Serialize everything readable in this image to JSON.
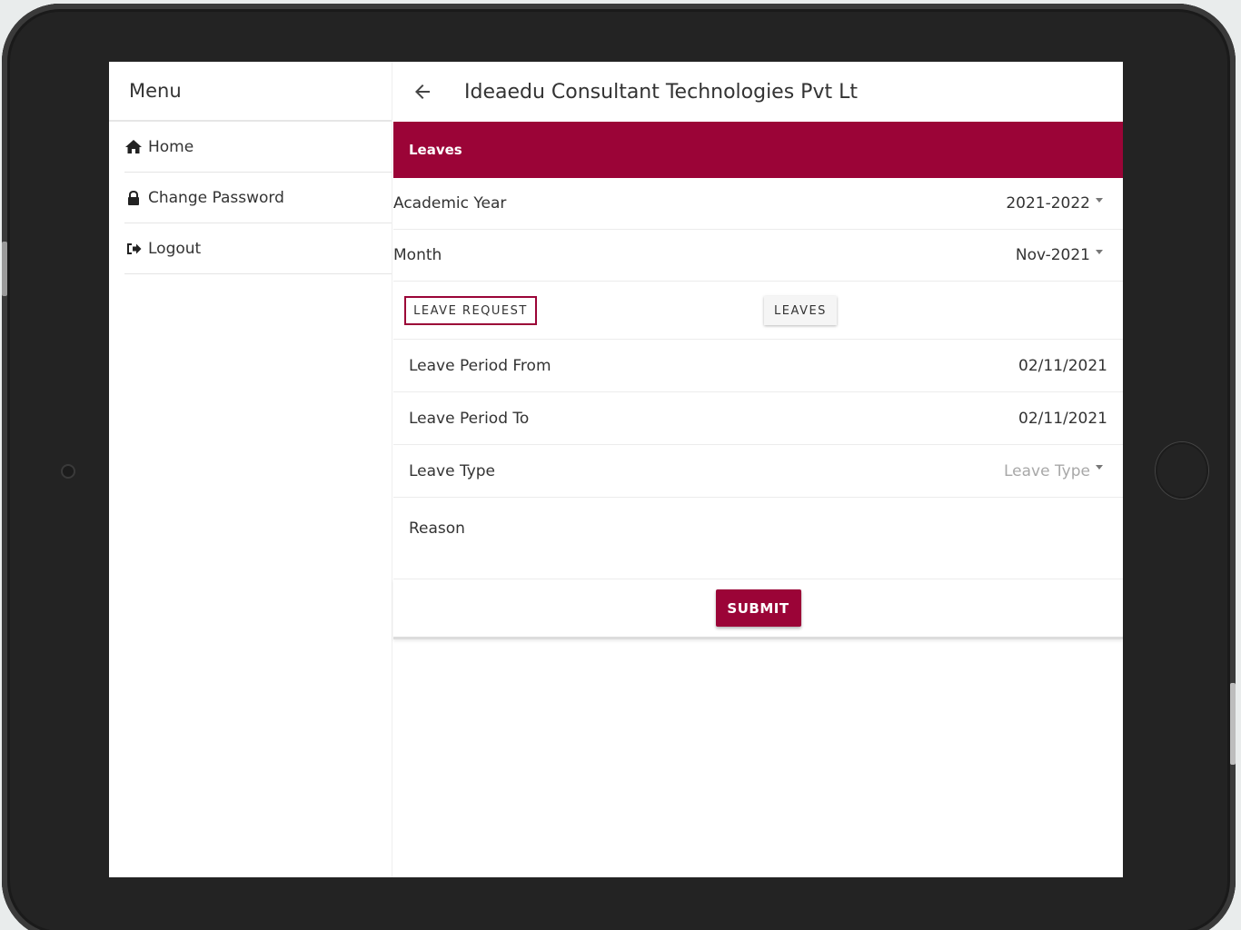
{
  "sidebar": {
    "title": "Menu",
    "items": [
      {
        "label": "Home",
        "icon": "home-icon"
      },
      {
        "label": "Change Password",
        "icon": "lock-icon"
      },
      {
        "label": "Logout",
        "icon": "logout-icon"
      }
    ]
  },
  "header": {
    "title": "Ideaedu Consultant Technologies Pvt Lt",
    "back_icon": "arrow-left-icon"
  },
  "panel": {
    "title": "Leaves",
    "accent_color": "#9b0437"
  },
  "filters": {
    "academic_year_label": "Academic Year",
    "academic_year_value": "2021-2022",
    "month_label": "Month",
    "month_value": "Nov-2021"
  },
  "tabs": {
    "leave_request": "LEAVE REQUEST",
    "leaves": "LEAVES"
  },
  "form": {
    "period_from_label": "Leave Period From",
    "period_from_value": "02/11/2021",
    "period_to_label": "Leave Period To",
    "period_to_value": "02/11/2021",
    "leave_type_label": "Leave Type",
    "leave_type_placeholder": "Leave Type",
    "reason_label": "Reason",
    "submit_label": "SUBMIT"
  }
}
